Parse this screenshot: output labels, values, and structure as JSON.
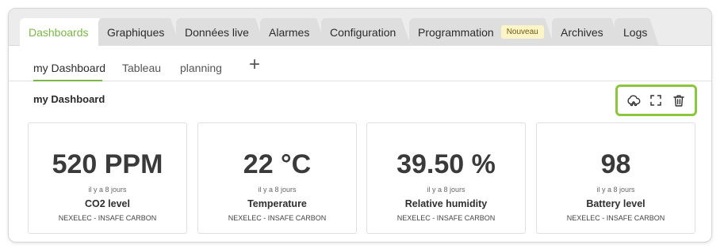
{
  "main_tabs": [
    {
      "label": "Dashboards"
    },
    {
      "label": "Graphiques"
    },
    {
      "label": "Données live"
    },
    {
      "label": "Alarmes"
    },
    {
      "label": "Configuration"
    },
    {
      "label": "Programmation",
      "badge": "Nouveau"
    },
    {
      "label": "Archives"
    },
    {
      "label": "Logs"
    }
  ],
  "sub_tabs": [
    {
      "label": "my Dashboard"
    },
    {
      "label": "Tableau"
    },
    {
      "label": "planning"
    }
  ],
  "add_tab_symbol": "+",
  "dashboard": {
    "title": "my Dashboard",
    "toolbar_icons": [
      "share-icon",
      "fullscreen-icon",
      "trash-icon"
    ]
  },
  "widgets": [
    {
      "value": "520 PPM",
      "time": "il y a 8 jours",
      "metric": "CO2 level",
      "device": "NEXELEC - INSAFE CARBON"
    },
    {
      "value": "22 °C",
      "time": "il y a 8 jours",
      "metric": "Temperature",
      "device": "NEXELEC - INSAFE CARBON"
    },
    {
      "value": "39.50 %",
      "time": "il y a 8 jours",
      "metric": "Relative humidity",
      "device": "NEXELEC - INSAFE CARBON"
    },
    {
      "value": "98",
      "time": "il y a 8 jours",
      "metric": "Battery level",
      "device": "NEXELEC - INSAFE CARBON"
    }
  ],
  "colors": {
    "accent": "#7ab648",
    "highlight_border": "#8cc63f",
    "badge_bg": "#fdf5c8"
  }
}
